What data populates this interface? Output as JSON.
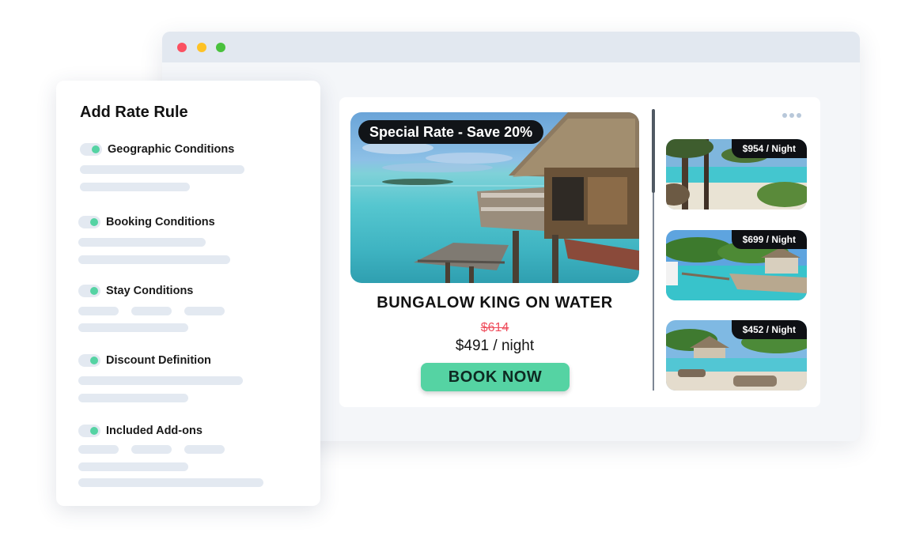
{
  "browser": {
    "window_controls": [
      "close",
      "minimize",
      "maximize"
    ]
  },
  "listing": {
    "badge": "Special Rate - Save 20%",
    "room_title": "BUNGALOW KING ON WATER",
    "old_price": "$614",
    "new_price": "$491 / night",
    "book_button": "BOOK NOW",
    "more_icon": "more-horizontal-icon",
    "accent_color": "#55d3a3",
    "strike_color": "#ef4d5c"
  },
  "thumbnails": [
    {
      "price": "$954 / Night"
    },
    {
      "price": "$699 / Night"
    },
    {
      "price": "$452 / Night"
    }
  ],
  "rule_panel": {
    "title": "Add Rate Rule",
    "conditions": [
      {
        "label": "Geographic Conditions",
        "enabled": true
      },
      {
        "label": "Booking Conditions",
        "enabled": true
      },
      {
        "label": "Stay Conditions",
        "enabled": true
      },
      {
        "label": "Discount Definition",
        "enabled": true
      },
      {
        "label": "Included Add-ons",
        "enabled": true
      }
    ]
  }
}
